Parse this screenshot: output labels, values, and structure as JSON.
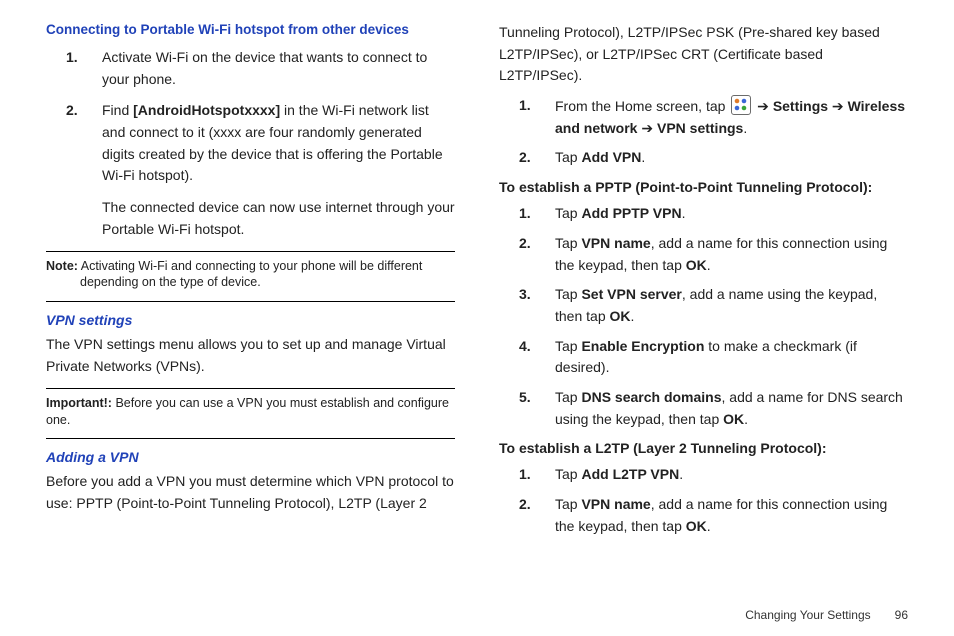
{
  "leftCol": {
    "heading1": "Connecting to Portable Wi-Fi hotspot from other devices",
    "steps1": [
      {
        "num": "1.",
        "text": "Activate Wi-Fi on the device that wants to connect to your phone."
      },
      {
        "num": "2.",
        "before": "Find ",
        "bold1": "[AndroidHotspotxxxx]",
        "after": " in the Wi-Fi network list and connect to it (xxxx are four randomly generated digits created by the device that is offering the Portable Wi-Fi hotspot)."
      }
    ],
    "steps1_after": "The connected device can now use internet through your Portable Wi-Fi hotspot.",
    "noteLabel": "Note:",
    "noteText": " Activating Wi-Fi and connecting to your phone will be different depending on the type of device.",
    "heading2": "VPN settings",
    "vpnIntro": "The VPN settings menu allows you to set up and manage Virtual Private Networks (VPNs).",
    "importantLabel": "Important!:",
    "importantText": " Before you can use a VPN you must establish and configure one.",
    "heading3": "Adding a VPN",
    "addVpnText": "Before you add a VPN you must determine which VPN protocol to use: PPTP (Point-to-Point Tunneling Protocol), L2TP (Layer 2"
  },
  "rightCol": {
    "contPara": "Tunneling Protocol), L2TP/IPSec PSK (Pre-shared key based L2TP/IPSec), or L2TP/IPSec CRT (Certificate based L2TP/IPSec).",
    "stepsA": [
      {
        "num": "1.",
        "pre": "From the Home screen, tap ",
        "arrow1": " ➔ ",
        "b1": "Settings",
        "arrow2": " ➔ ",
        "b2": "Wireless and network",
        "arrow3": " ➔ ",
        "b3": "VPN settings",
        "end": "."
      },
      {
        "num": "2.",
        "pre": "Tap ",
        "b1": "Add VPN",
        "end": "."
      }
    ],
    "sub1": "To establish a PPTP (Point-to-Point Tunneling Protocol):",
    "stepsB": [
      {
        "num": "1.",
        "pre": "Tap ",
        "b1": "Add PPTP VPN",
        "end": "."
      },
      {
        "num": "2.",
        "pre": "Tap ",
        "b1": "VPN name",
        "mid": ", add a name for this connection using the keypad, then tap ",
        "b2": "OK",
        "end": "."
      },
      {
        "num": "3.",
        "pre": "Tap ",
        "b1": "Set VPN server",
        "mid": ", add a name using the keypad, then tap ",
        "b2": "OK",
        "end": "."
      },
      {
        "num": "4.",
        "pre": "Tap ",
        "b1": "Enable Encryption",
        "mid": " to make a checkmark (if desired).",
        "end": ""
      },
      {
        "num": "5.",
        "pre": "Tap ",
        "b1": "DNS search domains",
        "mid": ", add a name for DNS search using the keypad, then tap ",
        "b2": "OK",
        "end": "."
      }
    ],
    "sub2": "To establish a L2TP (Layer 2 Tunneling Protocol):",
    "stepsC": [
      {
        "num": "1.",
        "pre": "Tap ",
        "b1": "Add L2TP VPN",
        "end": "."
      },
      {
        "num": "2.",
        "pre": "Tap ",
        "b1": "VPN name",
        "mid": ", add a name for this connection using the keypad, then tap ",
        "b2": "OK",
        "end": "."
      }
    ]
  },
  "footer": {
    "section": "Changing Your Settings",
    "page": "96"
  },
  "icons": {
    "apps": "apps-grid-icon"
  },
  "arrowGlyph": "➔"
}
